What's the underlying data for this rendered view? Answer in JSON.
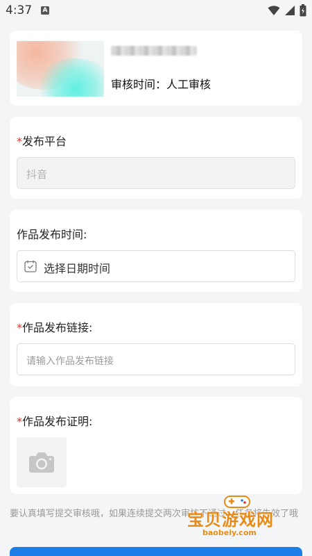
{
  "status_bar": {
    "time": "4:37",
    "app_icon_letter": "A",
    "icons": [
      "wifi-icon",
      "signal-icon",
      "battery-icon"
    ]
  },
  "task": {
    "title_blurred": "",
    "review_label": "审核时间：",
    "review_value": "人工审核"
  },
  "platform": {
    "required_mark": "*",
    "label": "发布平台",
    "value": "抖音"
  },
  "publish_time": {
    "label": "作品发布时间:",
    "placeholder": "选择日期时间"
  },
  "publish_link": {
    "required_mark": "*",
    "label": "作品发布链接:",
    "placeholder": "请输入作品发布链接"
  },
  "publish_proof": {
    "required_mark": "*",
    "label": "作品发布证明:"
  },
  "notice": "要认真填写提交审核哦，如果连续提交两次审核不通过，任务将失效了哦",
  "watermark": {
    "text": "宝贝游戏网",
    "site": "baobeiy.com"
  },
  "colors": {
    "primary": "#1e7ee8",
    "required": "#d9302c",
    "watermark": "#e88a16"
  }
}
